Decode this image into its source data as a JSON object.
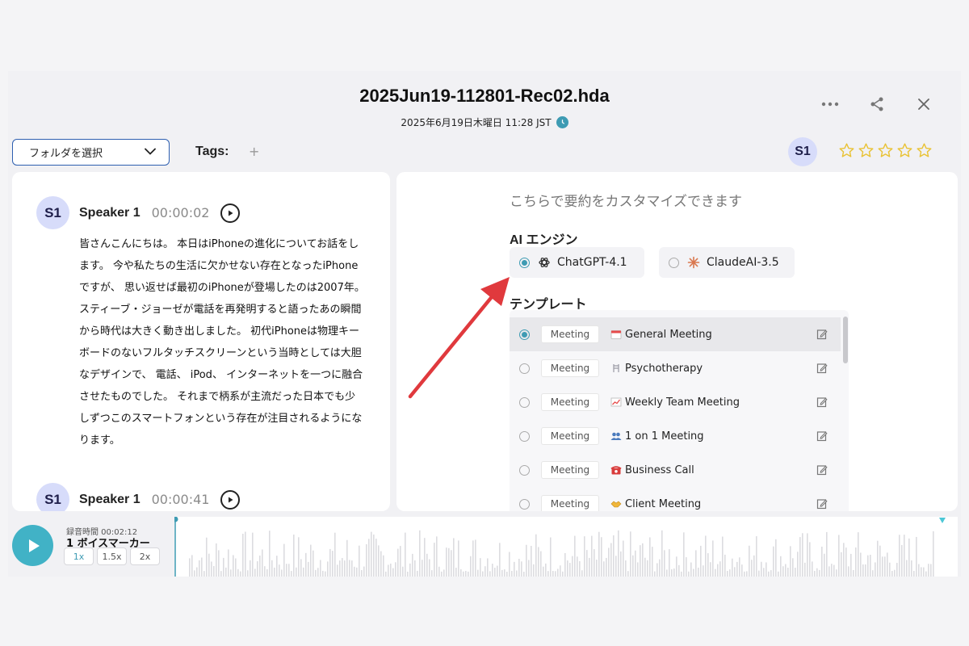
{
  "header": {
    "title": "2025Jun19-112801-Rec02.hda",
    "date": "2025年6月19日木曜日 11:28 JST"
  },
  "toolbar": {
    "folder_label": "フォルダを選択",
    "tags_label": "Tags:",
    "tag_add": "+",
    "speaker_avatar": "S1",
    "rating": 0,
    "rating_max": 5
  },
  "transcript": {
    "segments": [
      {
        "avatar": "S1",
        "speaker": "Speaker 1",
        "time": "00:00:02",
        "text": "皆さんこんにちは。 本日はiPhoneの進化についてお話をします。 今や私たちの生活に欠かせない存在となったiPhoneですが、 思い返せば最初のiPhoneが登場したのは2007年。 スティーブ・ジョーゼが電話を再発明すると語ったあの瞬間から時代は大きく動き出しました。 初代iPhoneは物理キーボードのないフルタッチスクリーンという当時としては大胆なデザインで、 電話、 iPod、 インターネットを一つに融合させたものでした。 それまで柄系が主流だった日本でも少しずつこのスマートフォンという存在が注目されるようになります。"
      },
      {
        "avatar": "S1",
        "speaker": "Speaker 1",
        "time": "00:00:41"
      }
    ]
  },
  "summary": {
    "heading": "こちらで要約をカスタマイズできます",
    "ai_label": "AI エンジン",
    "engines": [
      {
        "name": "ChatGPT-4.1",
        "selected": true,
        "icon": "openai-icon"
      },
      {
        "name": "ClaudeAI-3.5",
        "selected": false,
        "icon": "claude-icon"
      }
    ],
    "template_label": "テンプレート",
    "templates": [
      {
        "category": "Meeting",
        "name": "General Meeting",
        "icon": "calendar-icon",
        "selected": true
      },
      {
        "category": "Meeting",
        "name": "Psychotherapy",
        "icon": "chair-icon",
        "selected": false
      },
      {
        "category": "Meeting",
        "name": "Weekly Team Meeting",
        "icon": "chart-icon",
        "selected": false
      },
      {
        "category": "Meeting",
        "name": "1 on 1 Meeting",
        "icon": "people-icon",
        "selected": false
      },
      {
        "category": "Meeting",
        "name": "Business Call",
        "icon": "telephone-icon",
        "selected": false
      },
      {
        "category": "Meeting",
        "name": "Client Meeting",
        "icon": "handshake-icon",
        "selected": false
      }
    ]
  },
  "player": {
    "recording_time": "録音時間 00:02:12",
    "markers": "1 ボイスマーカー",
    "speeds": [
      "1x",
      "1.5x",
      "2x"
    ],
    "active_speed": "1x"
  },
  "colors": {
    "accent": "#3e9bb3",
    "play": "#41b2c6",
    "star": "#e9c234",
    "arrow": "#e0393d",
    "avatar_bg": "#d7dcfa",
    "folder_border": "#2e5fb0"
  }
}
